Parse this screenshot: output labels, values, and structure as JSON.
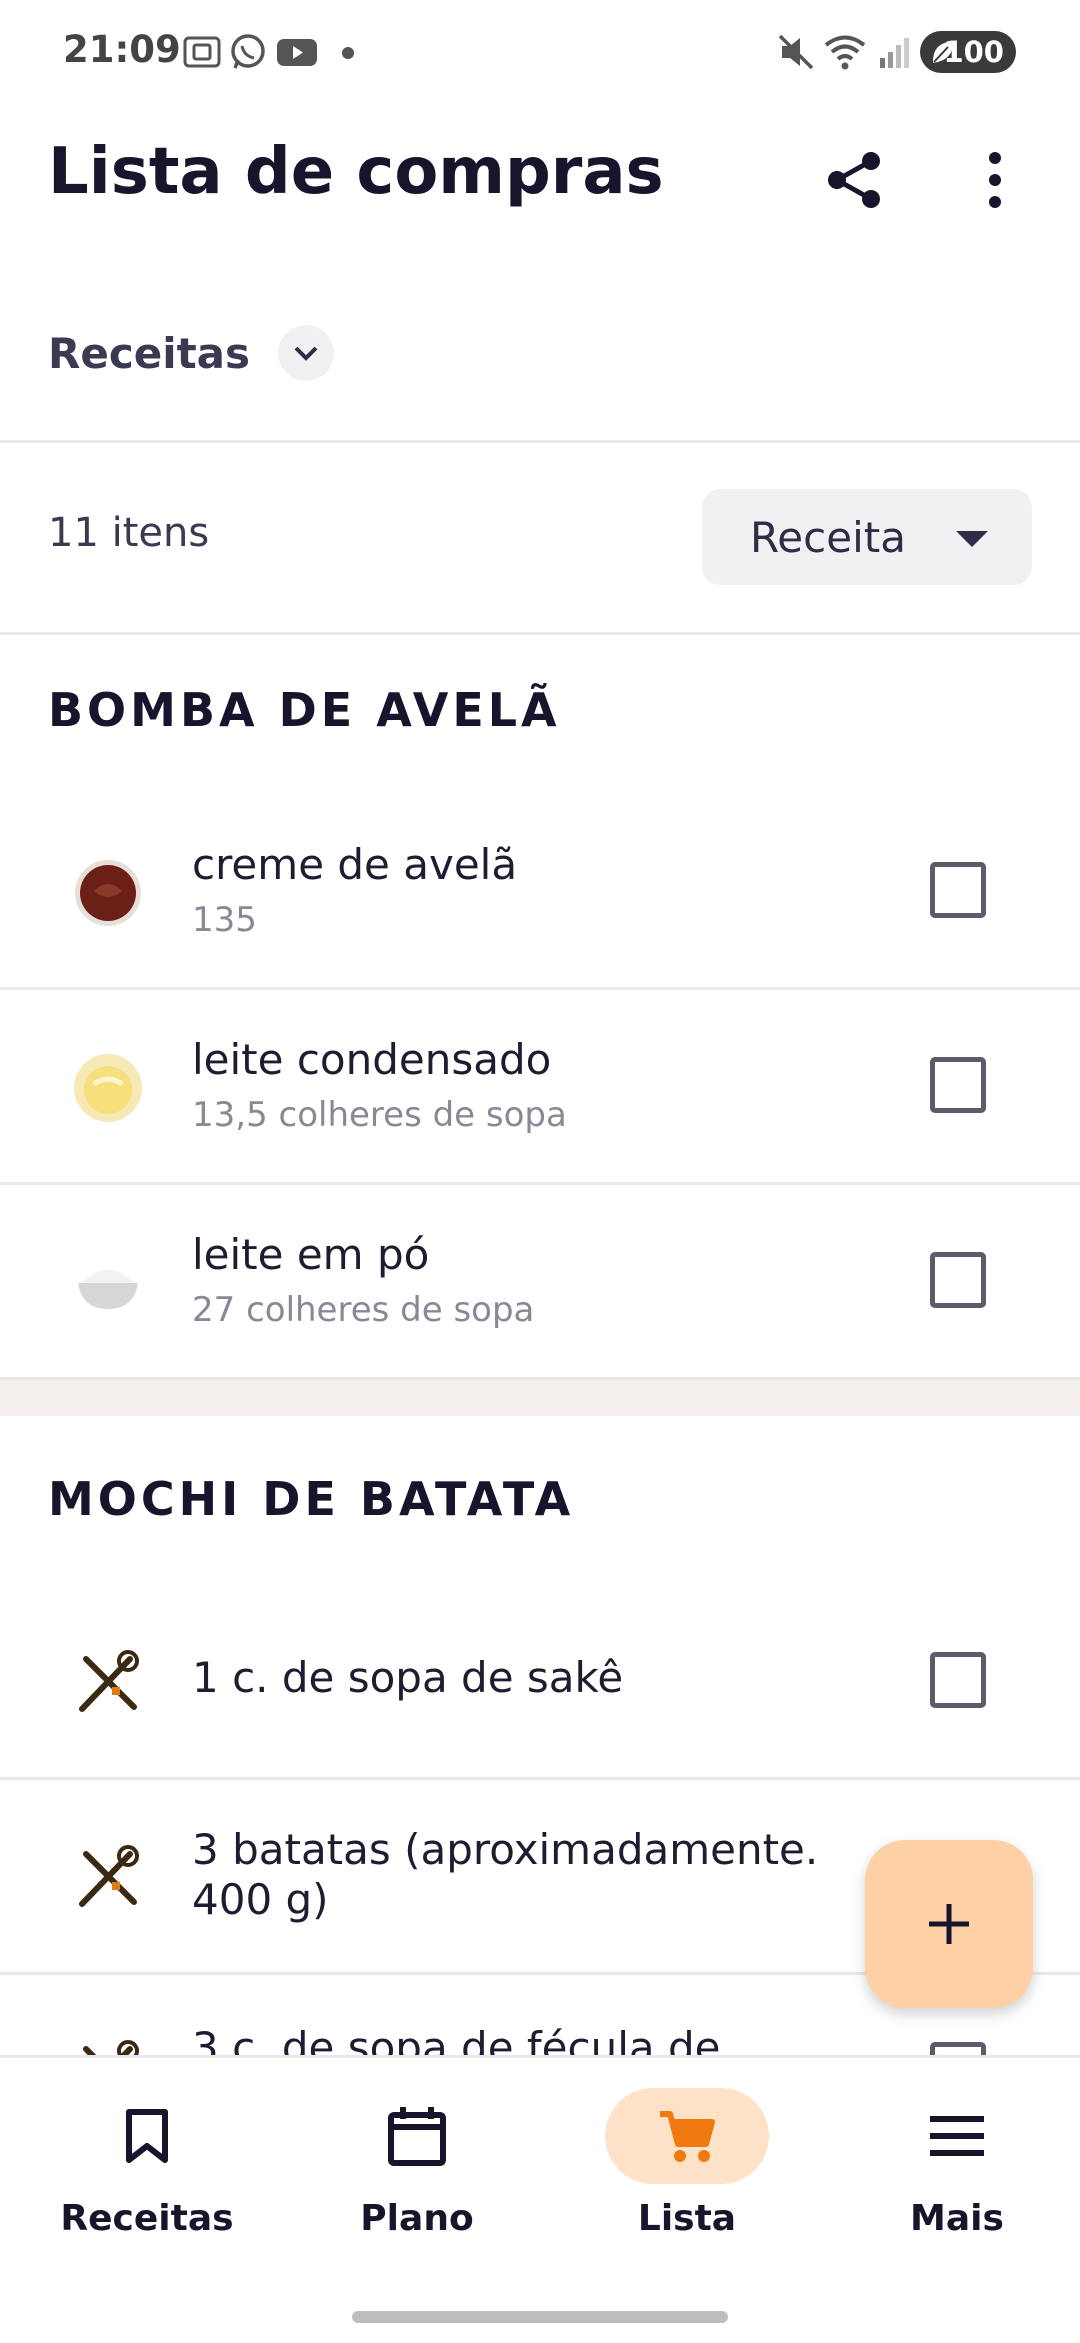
{
  "status": {
    "time": "21:09",
    "battery": "100",
    "icons": [
      "screenshot-icon",
      "whatsapp-icon",
      "youtube-icon",
      "dot-icon",
      "mute-icon",
      "wifi-icon",
      "signal-icon",
      "battery-icon"
    ]
  },
  "header": {
    "title": "Lista de compras",
    "icons": [
      "share-icon",
      "more-vert-icon"
    ]
  },
  "filter": {
    "label": "Receitas"
  },
  "summary": {
    "count": "11 itens",
    "sort_label": "Receita"
  },
  "sections": [
    {
      "title": "BOMBA DE AVELÃ",
      "items": [
        {
          "name": "creme de avelã",
          "qty": "135"
        },
        {
          "name": "leite condensado",
          "qty": "13,5 colheres de sopa"
        },
        {
          "name": "leite em pó",
          "qty": "27 colheres de sopa"
        }
      ]
    },
    {
      "title": "MOCHI DE BATATA",
      "items": [
        {
          "name": "1 c. de sopa de sakê"
        },
        {
          "name": "3 batatas (aproximadamente. 400 g)"
        },
        {
          "name": "3 c. de sopa de fécula de"
        }
      ]
    }
  ],
  "colors": {
    "accent": "#f07a10",
    "fab_bg": "#fdd0a6",
    "active_nav_bg": "#fde2c8",
    "text": "#16152b"
  },
  "nav": {
    "items": [
      {
        "label": "Receitas",
        "icon": "bookmark-icon"
      },
      {
        "label": "Plano",
        "icon": "calendar-icon"
      },
      {
        "label": "Lista",
        "icon": "cart-icon",
        "active": true
      },
      {
        "label": "Mais",
        "icon": "menu-icon"
      }
    ]
  },
  "fab": {
    "icon": "plus-icon"
  }
}
